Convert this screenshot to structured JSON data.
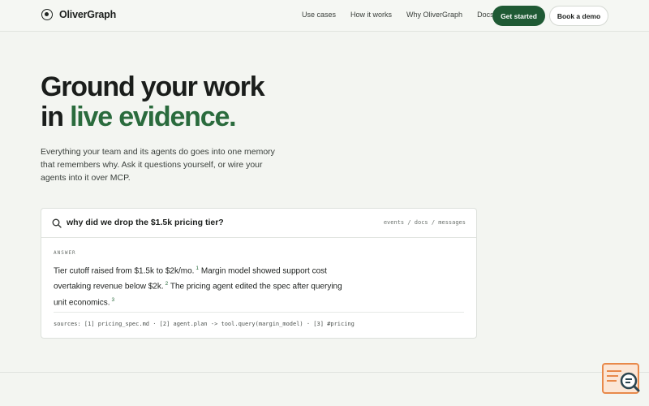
{
  "header": {
    "brand": "OliverGraph",
    "nav": [
      "Use cases",
      "How it works",
      "Why OliverGraph",
      "Docs"
    ],
    "primary_cta": "Get started",
    "secondary_cta": "Book a demo"
  },
  "hero": {
    "title_line1": "Ground your work",
    "title_line2_prefix": "in ",
    "title_line2_accent": "live evidence.",
    "subtitle": "Everything your team and its agents do goes into one memory that remembers why. Ask it questions yourself, or wire your agents into it over MCP."
  },
  "demo": {
    "query": "why did we drop the $1.5k pricing tier?",
    "scopes": "events / docs / messages",
    "answer_label": "ANSWER",
    "answer_parts": [
      {
        "text": "Tier cutoff raised from $1.5k to $2k/mo.",
        "ref": "1"
      },
      {
        "text": " Margin model showed support cost overtaking revenue below $2k.",
        "ref": "2"
      },
      {
        "text": " The pricing agent edited the spec after querying unit economics.",
        "ref": "3"
      }
    ],
    "sources": "sources: [1] pricing_spec.md · [2] agent.plan -> tool.query(margin_model) · [3] #pricing"
  },
  "icons": {
    "brand": "graph-node-icon",
    "search": "search-icon",
    "widget": "search-document-icon"
  },
  "colors": {
    "accent": "#2a6b3d",
    "primary_button": "#1f5a34",
    "background": "#f3f5f1"
  }
}
